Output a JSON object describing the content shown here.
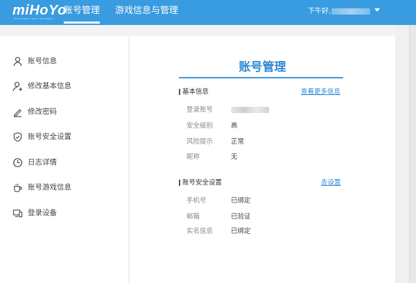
{
  "header": {
    "logo": "miHoYo",
    "logo_tagline": "TECH OTAKUS SAVE THE WORLD",
    "nav": [
      "账号管理",
      "游戏信息与管理"
    ],
    "greeting": "下午好,",
    "username": "••••••"
  },
  "sidebar": {
    "items": [
      {
        "label": "账号信息",
        "icon": "user-icon"
      },
      {
        "label": "修改基本信息",
        "icon": "user-edit-icon"
      },
      {
        "label": "修改密码",
        "icon": "pencil-icon"
      },
      {
        "label": "账号安全设置",
        "icon": "shield-icon"
      },
      {
        "label": "日志详情",
        "icon": "clock-icon"
      },
      {
        "label": "账号游戏信息",
        "icon": "cup-icon"
      },
      {
        "label": "登录设备",
        "icon": "devices-icon"
      }
    ]
  },
  "main": {
    "title": "账号管理",
    "basic": {
      "title": "基本信息",
      "link": "查看更多信息",
      "rows": [
        {
          "key": "登录账号",
          "value": "••••••"
        },
        {
          "key": "安全级别",
          "value": "高"
        },
        {
          "key": "风险提示",
          "value": "正常"
        },
        {
          "key": "昵称",
          "value": "无"
        }
      ]
    },
    "security": {
      "title": "账号安全设置",
      "link": "去设置",
      "rows": [
        {
          "key": "手机号",
          "value": "已绑定"
        },
        {
          "key": "邮箱",
          "value": "已验证"
        },
        {
          "key": "实名信息",
          "value": "已绑定"
        }
      ]
    }
  },
  "colors": {
    "header_bg": "#399be0",
    "accent": "#2f8ad6"
  }
}
